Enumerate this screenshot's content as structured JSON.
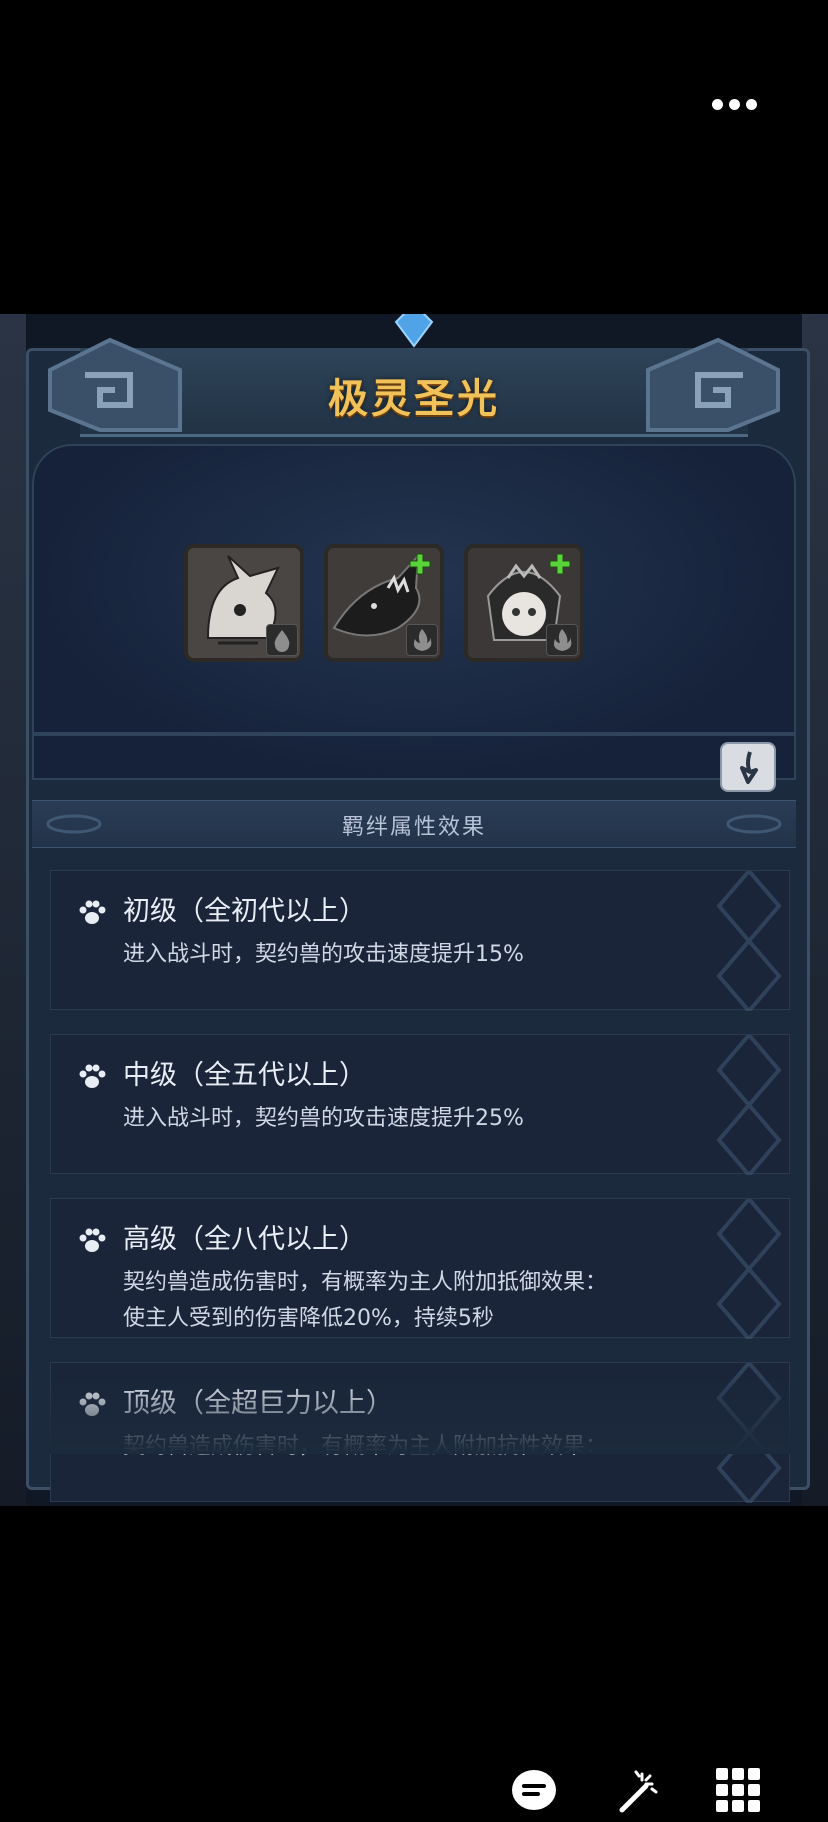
{
  "title": "极灵圣光",
  "bond_section_title": "羁绊属性效果",
  "pets": [
    {
      "name": "white-dragon-pet",
      "element": "water",
      "upgradable": false
    },
    {
      "name": "black-dragon-pet",
      "element": "fire",
      "upgradable": true
    },
    {
      "name": "armored-girl-pet",
      "element": "fire",
      "upgradable": true
    }
  ],
  "tiers": [
    {
      "name": "初级（全初代以上）",
      "desc": [
        "进入战斗时，契约兽的攻击速度提升15%"
      ]
    },
    {
      "name": "中级（全五代以上）",
      "desc": [
        "进入战斗时，契约兽的攻击速度提升25%"
      ]
    },
    {
      "name": "高级（全八代以上）",
      "desc": [
        "契约兽造成伤害时，有概率为主人附加抵御效果：",
        "使主人受到的伤害降低20%，持续5秒"
      ]
    },
    {
      "name": "顶级（全超巨力以上）",
      "desc": [
        "契约兽造成伤害时，有概率为主人附加抗性效果："
      ]
    }
  ],
  "icons": {
    "more": "more-dots-icon",
    "paw": "paw-icon",
    "down": "arrow-down-icon",
    "toolbar": [
      "chat-icon",
      "magic-wand-icon",
      "grid-icon"
    ]
  },
  "colors": {
    "title": "#f1c25a",
    "panel": "#1c2a3d",
    "plus": "#58d33a"
  }
}
